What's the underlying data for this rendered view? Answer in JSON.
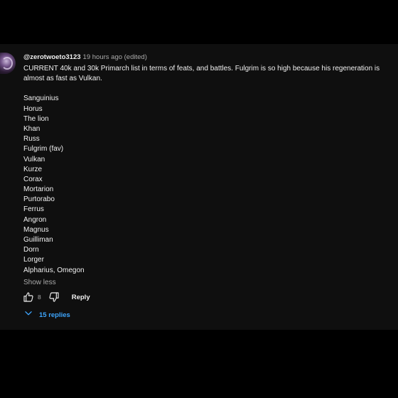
{
  "comment": {
    "author": "@zerotwoeto3123",
    "timestamp": "19 hours ago (edited)",
    "intro": "CURRENT 40k and 30k Primarch list in terms of feats, and battles. Fulgrim is so high because his regeneration is almost as fast as Vulkan.",
    "list": [
      "Sanguinius",
      "Horus",
      "The lion",
      "Khan",
      "Russ",
      "Fulgrim (fav)",
      "Vulkan",
      "Kurze",
      "Corax",
      "Mortarion",
      "Purtorabo",
      "Ferrus",
      "Angron",
      "Magnus",
      "Guilliman",
      "Dorn",
      "Lorger",
      "Alpharius, Omegon"
    ],
    "show_less_label": "Show less"
  },
  "actions": {
    "like_icon": "thumbs-up-icon",
    "like_count": "8",
    "dislike_icon": "thumbs-down-icon",
    "reply_label": "Reply"
  },
  "replies": {
    "icon": "chevron-down-icon",
    "label": "15 replies",
    "color": "#3ea6ff"
  },
  "colors": {
    "page_background": "#000000",
    "panel_background": "#0f0f0f",
    "primary_text": "#f1f1f1",
    "secondary_text": "#aaaaaa",
    "link_accent": "#3ea6ff"
  }
}
